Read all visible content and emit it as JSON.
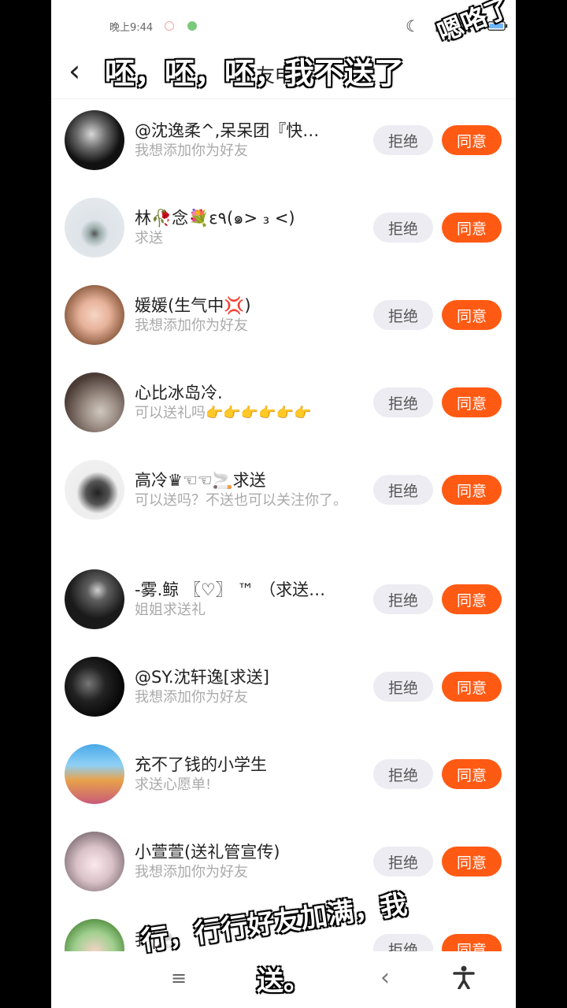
{
  "status_bar": {
    "time": "晚上9:44"
  },
  "header": {
    "title": "好友申请"
  },
  "buttons": {
    "reject": "拒绝",
    "accept": "同意"
  },
  "requests": [
    {
      "name": "@沈逸柔^,呆呆团『快…",
      "message": "我想添加你为好友"
    },
    {
      "name": "林🥀念💐ε٩(๑> ₃ <)",
      "message": "求送"
    },
    {
      "name": "媛媛(生气中💢)",
      "message": "我想添加你为好友"
    },
    {
      "name": "心比冰岛冷.",
      "message": "可以送礼吗👉👉👉👉👉👉"
    },
    {
      "name": "高冷♛☜☜🚬求送",
      "message": "可以送吗？不送也可以关注你了。"
    },
    {
      "name": "-雾.鲸 〖♡〗 ™ （求送…",
      "message": "姐姐求送礼"
    },
    {
      "name": "@SY.沈轩逸[求送]",
      "message": "我想添加你为好友"
    },
    {
      "name": "充不了钱的小学生",
      "message": "求送心愿单!"
    },
    {
      "name": "小萱萱(送礼管宣传)",
      "message": "我想添加你为好友"
    },
    {
      "name": "我|🚬",
      "message": ""
    }
  ],
  "captions": {
    "top": "呸，呸，呸，我不送了",
    "corner": "嗯咯了",
    "bottom_line1": "行，行行好友加满，我",
    "bottom_line2": "送。"
  }
}
